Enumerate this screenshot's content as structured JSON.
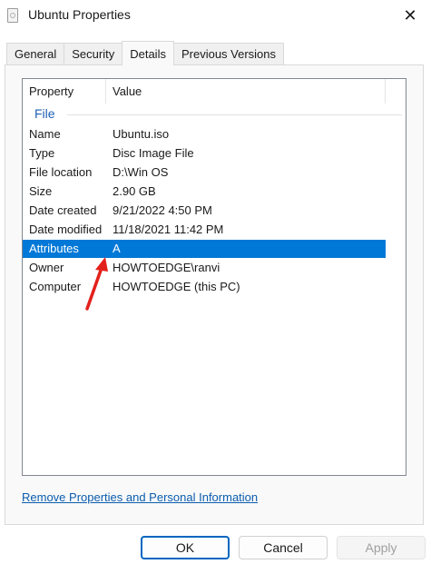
{
  "window": {
    "title": "Ubuntu Properties",
    "icon": "file-icon",
    "close_glyph": "✕"
  },
  "tabs": [
    {
      "label": "General",
      "active": false
    },
    {
      "label": "Security",
      "active": false
    },
    {
      "label": "Details",
      "active": true
    },
    {
      "label": "Previous Versions",
      "active": false
    }
  ],
  "details": {
    "columns": {
      "property": "Property",
      "value": "Value"
    },
    "group": "File",
    "rows": [
      {
        "property": "Name",
        "value": "Ubuntu.iso"
      },
      {
        "property": "Type",
        "value": "Disc Image File"
      },
      {
        "property": "File location",
        "value": "D:\\Win OS"
      },
      {
        "property": "Size",
        "value": "2.90 GB"
      },
      {
        "property": "Date created",
        "value": "9/21/2022 4:50 PM"
      },
      {
        "property": "Date modified",
        "value": "11/18/2021 11:42 PM"
      },
      {
        "property": "Attributes",
        "value": "A"
      },
      {
        "property": "Owner",
        "value": "HOWTOEDGE\\ranvi"
      },
      {
        "property": "Computer",
        "value": "HOWTOEDGE (this PC)"
      }
    ],
    "selected_row": "Attributes"
  },
  "link": "Remove Properties and Personal Information",
  "buttons": {
    "ok": "OK",
    "cancel": "Cancel",
    "apply": "Apply"
  },
  "colors": {
    "selection": "#0078d7",
    "annotation_arrow": "#e3211c",
    "link": "#0b5cad"
  }
}
